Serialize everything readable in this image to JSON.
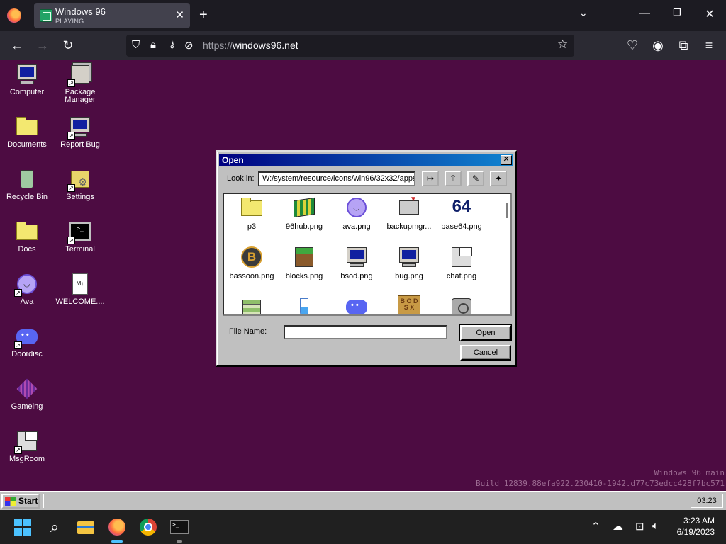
{
  "browser": {
    "tab": {
      "title": "Windows 96",
      "subtitle": "PLAYING"
    },
    "url": {
      "scheme": "https://",
      "host": "windows96.net"
    }
  },
  "desktop": {
    "icons": [
      {
        "label": "Computer",
        "icon": "computer-icon"
      },
      {
        "label": "Package Manager",
        "icon": "package-manager-icon"
      },
      {
        "label": "Documents",
        "icon": "folder-icon"
      },
      {
        "label": "Report Bug",
        "icon": "report-bug-icon"
      },
      {
        "label": "Recycle Bin",
        "icon": "recycle-bin-icon"
      },
      {
        "label": "Settings",
        "icon": "settings-icon"
      },
      {
        "label": "Docs",
        "icon": "folder-icon"
      },
      {
        "label": "Terminal",
        "icon": "terminal-icon"
      },
      {
        "label": "Ava",
        "icon": "ava-icon"
      },
      {
        "label": "WELCOME....",
        "icon": "markdown-file-icon"
      },
      {
        "label": "Doordisc",
        "icon": "discord-icon"
      },
      {
        "label": "Gameing",
        "icon": "cube-icon"
      },
      {
        "label": "MsgRoom",
        "icon": "msgroom-icon"
      }
    ],
    "build_line1": "Windows 96 main",
    "build_line2": "Build 12839.88efa922.230410-1942.d77c73edcc428f7bc571"
  },
  "dialog": {
    "title": "Open",
    "lookin_label": "Look in:",
    "lookin_path": "W:/system/resource/icons/win96/32x32/apps",
    "filename_label": "File Name:",
    "filename_value": "",
    "open_label": "Open",
    "cancel_label": "Cancel",
    "files": [
      {
        "name": "p3",
        "icon": "folder-icon"
      },
      {
        "name": "96hub.png",
        "icon": "96hub-icon"
      },
      {
        "name": "ava.png",
        "icon": "ava-icon"
      },
      {
        "name": "backupmgr...",
        "icon": "backup-icon"
      },
      {
        "name": "base64.png",
        "icon": "base64-icon"
      },
      {
        "name": "bassoon.png",
        "icon": "bassoon-icon"
      },
      {
        "name": "blocks.png",
        "icon": "blocks-icon"
      },
      {
        "name": "bsod.png",
        "icon": "bsod-icon"
      },
      {
        "name": "bug.png",
        "icon": "bug-icon"
      },
      {
        "name": "chat.png",
        "icon": "chat-icon"
      },
      {
        "name": "",
        "icon": "books-icon"
      },
      {
        "name": "",
        "icon": "flask-icon"
      },
      {
        "name": "",
        "icon": "discord-icon"
      },
      {
        "name": "",
        "icon": "dosbox-icon"
      },
      {
        "name": "",
        "icon": "camera-icon"
      }
    ],
    "base64_glyph": "64",
    "bassoon_glyph": "B",
    "dosbox_glyph": "B O D S X"
  },
  "w96_taskbar": {
    "start_label": "Start",
    "clock": "03:23"
  },
  "windows_taskbar": {
    "time": "3:23 AM",
    "date": "6/19/2023"
  },
  "colors": {
    "desktop": "#4d0c42",
    "titlebar": "#000080",
    "face": "#c0c0c0"
  }
}
